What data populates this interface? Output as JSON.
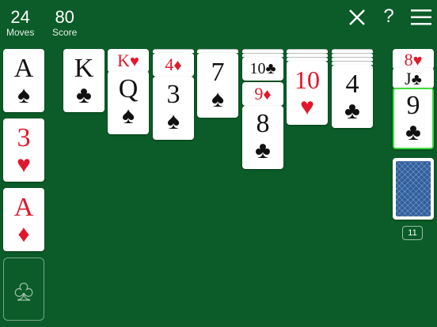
{
  "header": {
    "moves_value": "24",
    "moves_label": "Moves",
    "score_value": "80",
    "score_label": "Score"
  },
  "foundations": [
    {
      "rank": "A",
      "suit": "♠",
      "color": "black"
    },
    {
      "rank": "3",
      "suit": "♥",
      "color": "red"
    },
    {
      "rank": "A",
      "suit": "♦",
      "color": "red"
    },
    {
      "empty_suit": "♣"
    }
  ],
  "tableau": [
    {
      "top": {
        "rank": "K",
        "suit": "♣"
      }
    },
    {
      "partial": {
        "rank": "K",
        "suit": "♥"
      },
      "top": {
        "rank": "Q",
        "suit": "♠"
      }
    },
    {
      "partial": {
        "rank": "4",
        "suit": "♦"
      },
      "top": {
        "rank": "3",
        "suit": "♠"
      }
    },
    {
      "top": {
        "rank": "7",
        "suit": "♠"
      }
    },
    {
      "partial1": {
        "rank": "10",
        "suit": "♣"
      },
      "partial2": {
        "rank": "9",
        "suit": "♦"
      },
      "top": {
        "rank": "8",
        "suit": "♣"
      }
    },
    {
      "top": {
        "rank": "10",
        "suit": "♥"
      }
    },
    {
      "top": {
        "rank": "4",
        "suit": "♣"
      }
    }
  ],
  "waste": {
    "partial1": {
      "rank": "8",
      "suit": "♥"
    },
    "partial2": {
      "rank": "J",
      "suit": "♣"
    },
    "top": {
      "rank": "9",
      "suit": "♣"
    }
  },
  "stock": {
    "count": "11"
  },
  "colors": {
    "felt": "#0b5c28",
    "red": "#e0182c",
    "highlight": "#3ddc3d",
    "card_back": "#2f5f9e"
  },
  "icons": {
    "close": "close-icon",
    "help": "help-icon",
    "menu": "menu-icon"
  }
}
